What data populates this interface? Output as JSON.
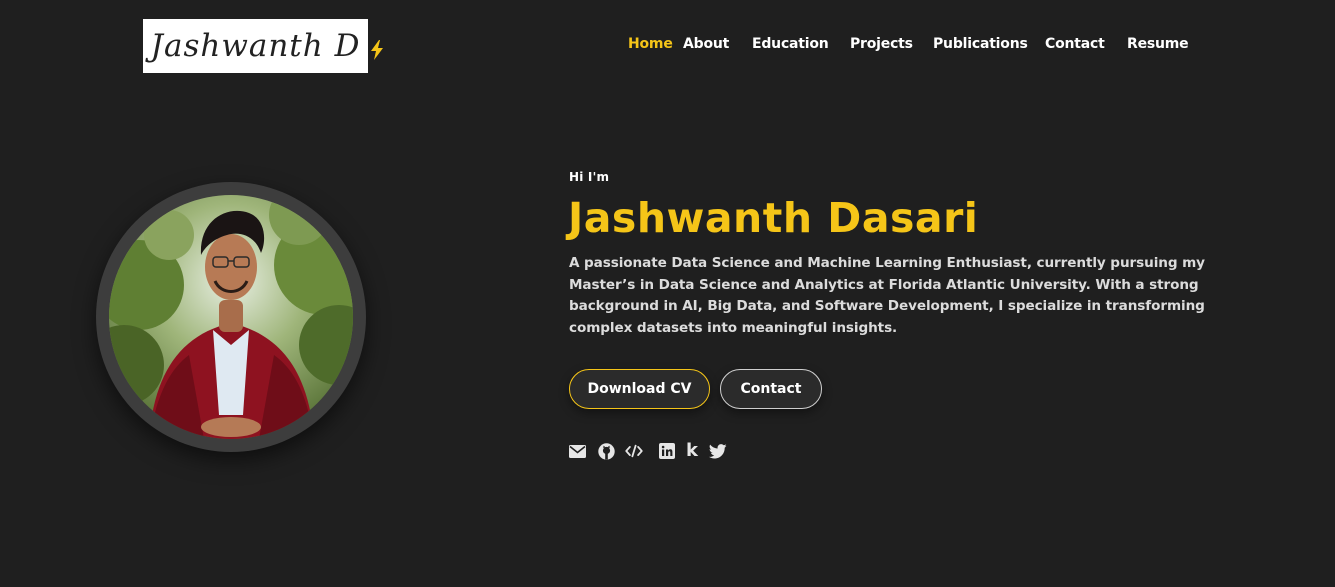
{
  "header": {
    "logo_text": "Jashwanth D",
    "nav": [
      {
        "label": "Home",
        "active": true
      },
      {
        "label": "About",
        "active": false
      },
      {
        "label": "Education",
        "active": false
      },
      {
        "label": "Projects",
        "active": false
      },
      {
        "label": "Publications",
        "active": false
      },
      {
        "label": "Contact",
        "active": false
      },
      {
        "label": "Resume",
        "active": false
      }
    ]
  },
  "hero": {
    "greeting": "Hi I'm",
    "name": "Jashwanth Dasari",
    "description": "A passionate Data Science and Machine Learning Enthusiast, currently pursuing my Master’s in Data Science and Analytics at Florida Atlantic University. With a strong background in AI, Big Data, and Software Development, I specialize in transforming complex datasets into meaningful insights.",
    "buttons": {
      "download_cv": "Download CV",
      "contact": "Contact"
    },
    "socials": [
      "email-icon",
      "github-icon",
      "code-icon",
      "linkedin-icon",
      "kaggle-icon",
      "twitter-icon"
    ]
  },
  "colors": {
    "background": "#1f1f1f",
    "accent": "#f5c518",
    "text": "#ffffff"
  }
}
